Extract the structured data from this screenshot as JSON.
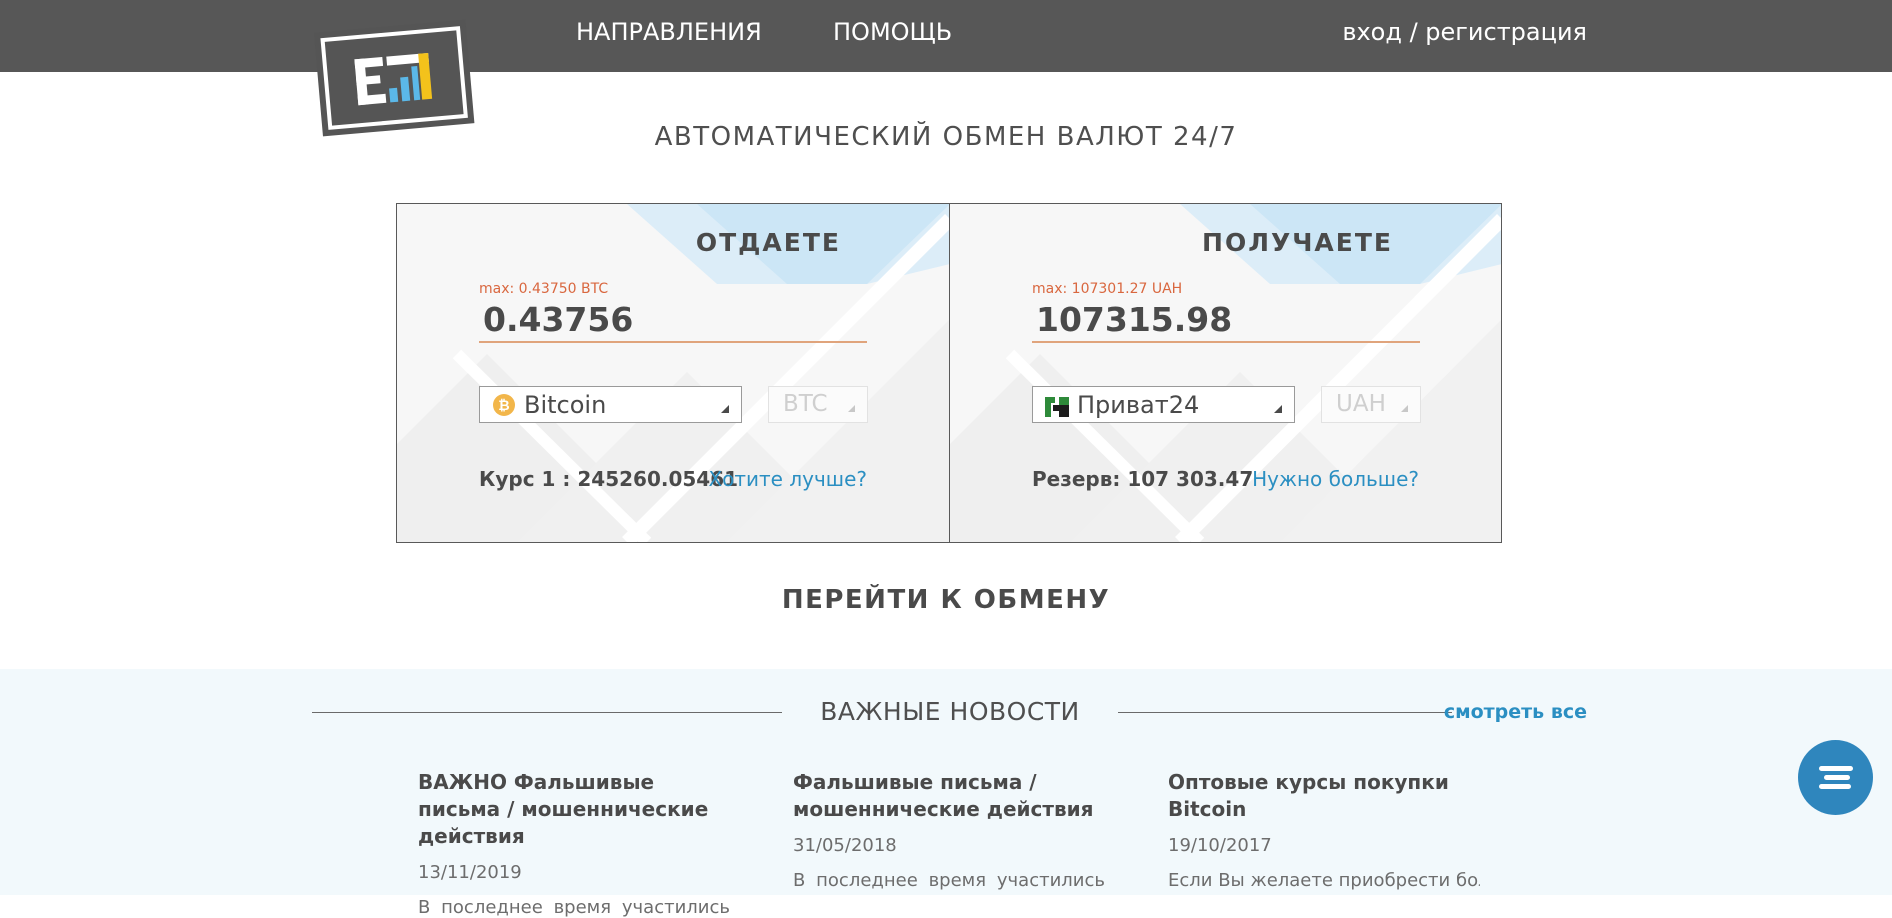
{
  "nav": {
    "directions": "НАПРАВЛЕНИЯ",
    "help": "ПОМОЩЬ",
    "auth": "вход / регистрация"
  },
  "headline": "АВТОМАТИЧЕСКИЙ ОБМЕН ВАЛЮТ 24/7",
  "give": {
    "title": "ОТДАЕТЕ",
    "max": "max: 0.43750 BTC",
    "amount": "0.43756",
    "method": "Bitcoin",
    "method_icon": "bitcoin-icon",
    "currency": "BTC",
    "rate": "Курс 1 : 245260.05461",
    "link": "Хотите лучше?"
  },
  "receive": {
    "title": "ПОЛУЧАЕТЕ",
    "max": "max: 107301.27 UAH",
    "amount": "107315.98",
    "method": "Приват24",
    "method_icon": "privat24-icon",
    "currency": "UAH",
    "reserve": "Резерв: 107 303.47",
    "link": "Нужно больше?"
  },
  "go_button": "ПЕРЕЙТИ К ОБМЕНУ",
  "news": {
    "title": "ВАЖНЫЕ НОВОСТИ",
    "see_all": "смотреть все",
    "items": [
      {
        "title": "ВАЖНО Фальшивые письма / мошеннические действия",
        "date": "13/11/2019",
        "text": "В последнее время участились"
      },
      {
        "title": "Фальшивые письма / мошеннические действия",
        "date": "31/05/2018",
        "text": "В последнее время участились"
      },
      {
        "title": "Оптовые курсы покупки Bitcoin",
        "date": "19/10/2017",
        "text": "Если Вы желаете приобрести более"
      }
    ]
  },
  "colors": {
    "topbar": "#575757",
    "accent_link": "#2b8fc2",
    "max_label": "#d9673f",
    "news_bg": "#f2f9fc",
    "chat_button": "#2f86bd"
  }
}
